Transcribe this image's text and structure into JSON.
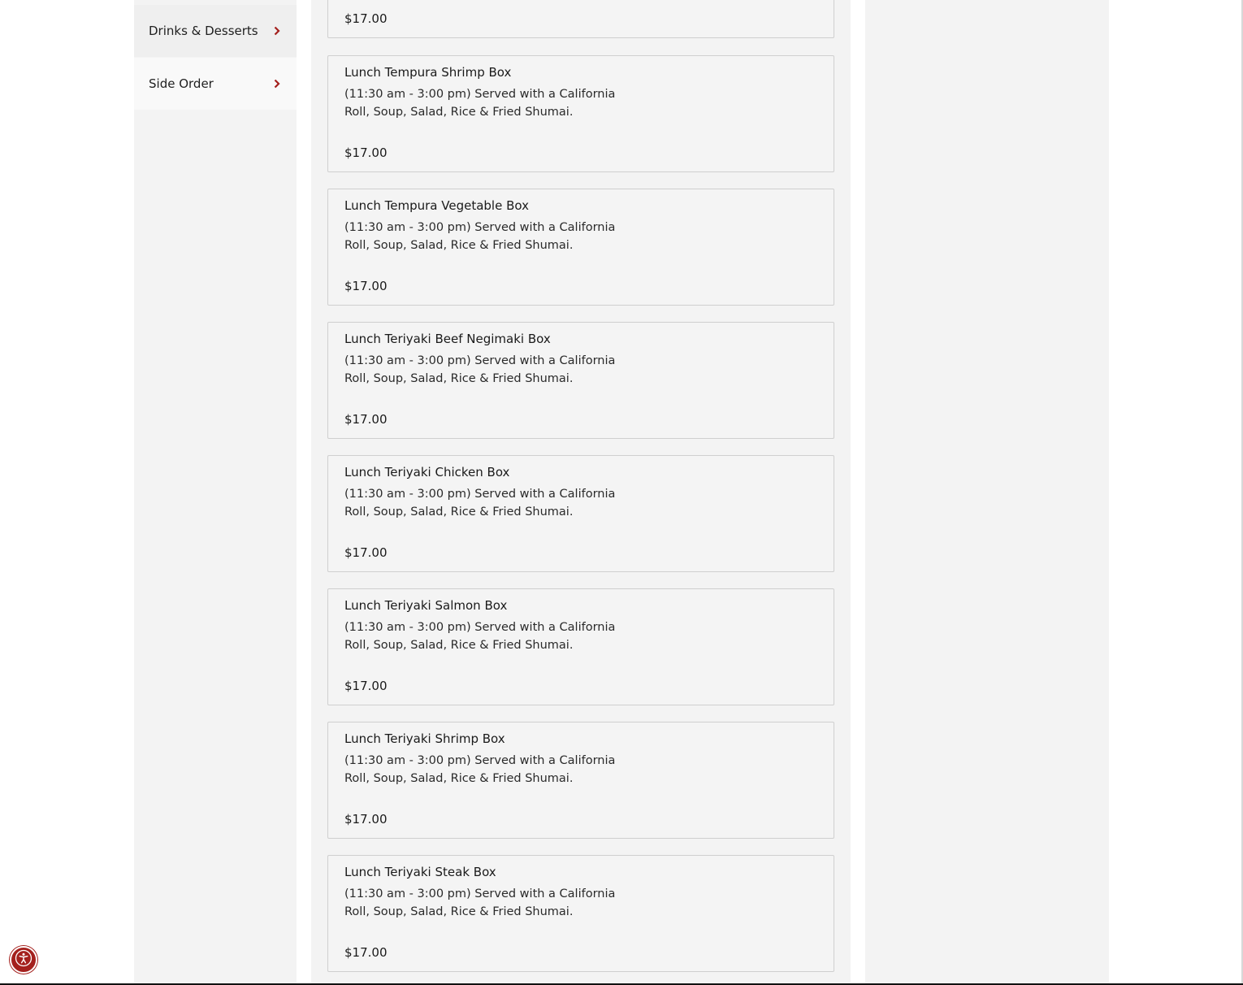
{
  "sidebar": {
    "items": [
      {
        "label": "Drinks & Desserts",
        "icon": "chevron-right-icon"
      },
      {
        "label": "Side Order",
        "icon": "chevron-right-icon"
      }
    ]
  },
  "menu": {
    "partial_item": {
      "price": "$17.00"
    },
    "items": [
      {
        "title": "Lunch Tempura Shrimp Box",
        "description": "(11:30 am - 3:00 pm) Served with a California Roll, Soup, Salad, Rice & Fried Shumai.",
        "price": "$17.00"
      },
      {
        "title": "Lunch Tempura Vegetable Box",
        "description": "(11:30 am - 3:00 pm) Served with a California Roll, Soup, Salad, Rice & Fried Shumai.",
        "price": "$17.00"
      },
      {
        "title": "Lunch Teriyaki Beef Negimaki Box",
        "description": "(11:30 am - 3:00 pm) Served with a California Roll, Soup, Salad, Rice & Fried Shumai.",
        "price": "$17.00"
      },
      {
        "title": "Lunch Teriyaki Chicken Box",
        "description": "(11:30 am - 3:00 pm) Served with a California Roll, Soup, Salad, Rice & Fried Shumai.",
        "price": "$17.00"
      },
      {
        "title": "Lunch Teriyaki Salmon Box",
        "description": "(11:30 am - 3:00 pm) Served with a California Roll, Soup, Salad, Rice & Fried Shumai.",
        "price": "$17.00"
      },
      {
        "title": "Lunch Teriyaki Shrimp Box",
        "description": "(11:30 am - 3:00 pm) Served with a California Roll, Soup, Salad, Rice & Fried Shumai.",
        "price": "$17.00"
      },
      {
        "title": "Lunch Teriyaki Steak Box",
        "description": "(11:30 am - 3:00 pm) Served with a California Roll, Soup, Salad, Rice & Fried Shumai.",
        "price": "$17.00"
      }
    ]
  },
  "accessibility": {
    "icon": "accessibility-icon"
  },
  "colors": {
    "accent": "#a4201d",
    "panel_bg": "#f3f3f3",
    "card_border": "#cfcfcf"
  }
}
